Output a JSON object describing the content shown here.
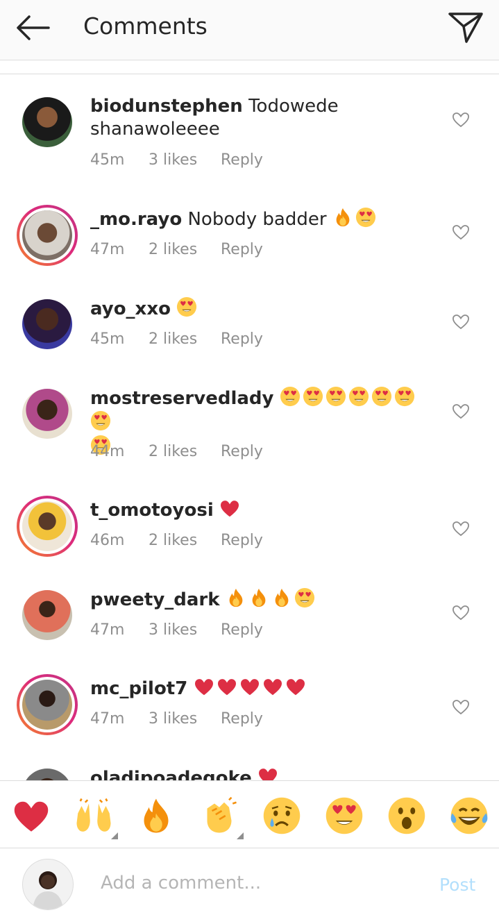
{
  "header": {
    "title": "Comments"
  },
  "comments": [
    {
      "username": "biodunstephen",
      "text": "Todowede",
      "text2": "shanawoleeee",
      "time": "45m",
      "likes": "3 likes",
      "reply": "Reply"
    },
    {
      "username": "_mo.rayo",
      "text": "Nobody badder",
      "time": "47m",
      "likes": "2 likes",
      "reply": "Reply"
    },
    {
      "username": "ayo_xxo",
      "text": "",
      "time": "45m",
      "likes": "2 likes",
      "reply": "Reply"
    },
    {
      "username": "mostreservedlady",
      "text": "",
      "time": "44m",
      "likes": "2 likes",
      "reply": "Reply"
    },
    {
      "username": "t_omotoyosi",
      "text": "",
      "time": "46m",
      "likes": "2 likes",
      "reply": "Reply"
    },
    {
      "username": "pweety_dark",
      "text": "",
      "time": "47m",
      "likes": "3 likes",
      "reply": "Reply"
    },
    {
      "username": "mc_pilot7",
      "text": "",
      "time": "47m",
      "likes": "3 likes",
      "reply": "Reply"
    },
    {
      "username": "oladipoadegoke",
      "text": ""
    }
  ],
  "reactions": [
    "red-heart",
    "raising-hands",
    "fire",
    "clapping-hands",
    "crying-face",
    "heart-eyes",
    "surprised-face",
    "tears-of-joy"
  ],
  "composer": {
    "placeholder": "Add a comment...",
    "post_label": "Post"
  },
  "colors": {
    "accent": "#0095f6",
    "post_disabled": "#b2dffc",
    "meta": "#8e8e8e",
    "ring_start": "#f58529",
    "ring_end": "#c13584"
  }
}
